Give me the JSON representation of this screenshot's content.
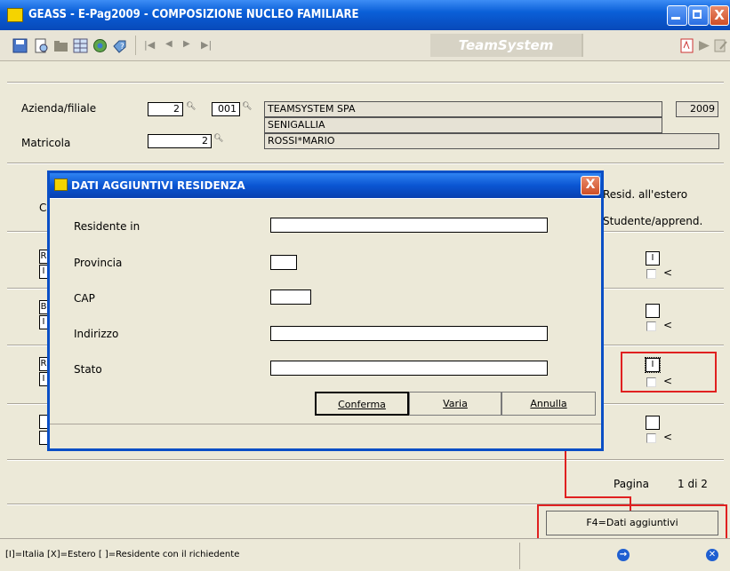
{
  "window": {
    "title": "GEASS  - E-Pag2009  -  COMPOSIZIONE NUCLEO FAMILIARE",
    "minimize": "",
    "close": "X"
  },
  "toolbar": {
    "nav_first": "|◀",
    "nav_prev": "◀",
    "nav_next": "▶",
    "nav_last": "▶|",
    "brand": "TeamSystem"
  },
  "header": {
    "azienda_label": "Azienda/filiale",
    "azienda_value": "2",
    "filiale_value": "001",
    "company_name": "TEAMSYSTEM SPA",
    "city": "SENIGALLIA",
    "year": "2009",
    "matricola_label": "Matricola",
    "matricola_value": "2",
    "employee_name": "ROSSI*MARIO"
  },
  "grid": {
    "col_c_label": "C",
    "col_resid_label": "Resid. all'estero",
    "col_studente_label": "Studente/apprend.",
    "rows": [
      {
        "c1": "R",
        "c2": "I",
        "resid": "I",
        "arrow": "<"
      },
      {
        "c1": "B",
        "c2": "I",
        "resid": "",
        "arrow": "<"
      },
      {
        "c1": "R",
        "c2": "I",
        "resid": "I",
        "arrow": "<"
      },
      {
        "c1": "",
        "c2": "",
        "resid": "",
        "arrow": "<"
      }
    ],
    "pagina_label": "Pagina",
    "pagina_value": "1 di 2"
  },
  "f4_button": "F4=Dati aggiuntivi",
  "status": {
    "legend": "[I]=Italia [X]=Estero [ ]=Residente con il richiedente"
  },
  "dialog": {
    "title": "DATI AGGIUNTIVI RESIDENZA",
    "close": "X",
    "fields": {
      "residente_in_label": "Residente in",
      "provincia_label": "Provincia",
      "cap_label": "CAP",
      "indirizzo_label": "Indirizzo",
      "stato_label": "Stato"
    },
    "buttons": {
      "conferma": "Conferma",
      "varia": "Varia",
      "annulla": "Annulla"
    }
  },
  "colors": {
    "titlebar": "#0a5fd8",
    "highlight_red": "#e02020",
    "window_bg": "#ece9d8"
  }
}
